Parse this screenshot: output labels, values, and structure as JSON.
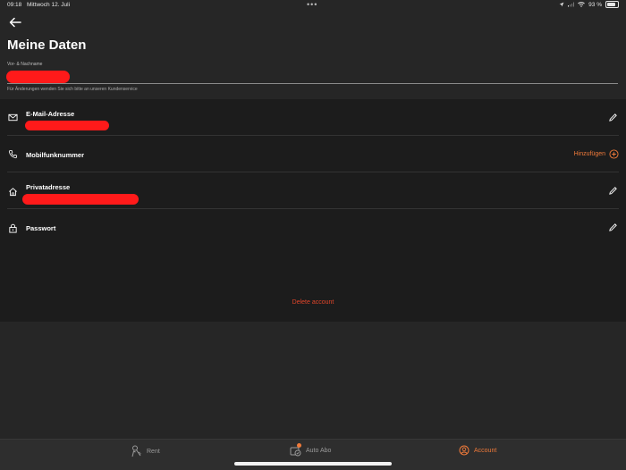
{
  "status_bar": {
    "time": "09:18",
    "date": "Mittwoch 12. Juli",
    "battery": "93 %"
  },
  "page": {
    "title": "Meine Daten",
    "name_label": "Vor- & Nachname",
    "hint": "Für Änderungen wenden Sie sich bitte an unseren Kundenservice"
  },
  "rows": {
    "email": {
      "label": "E-Mail-Adresse",
      "icon": "mail-icon"
    },
    "phone": {
      "label": "Mobilfunknummer",
      "icon": "phone-icon",
      "action_label": "Hinzufügen"
    },
    "address": {
      "label": "Privatadresse",
      "icon": "home-icon"
    },
    "password": {
      "label": "Passwort",
      "icon": "lock-icon"
    }
  },
  "delete_label": "Delete account",
  "tabs": [
    {
      "label": "Rent",
      "icon": "rent-icon",
      "active": false
    },
    {
      "label": "Auto Abo",
      "icon": "auto-abo-icon",
      "active": false
    },
    {
      "label": "Account",
      "icon": "account-icon",
      "active": true
    }
  ],
  "colors": {
    "accent": "#f07a3a",
    "danger": "#e0452a",
    "background": "#262626",
    "card": "#1c1c1c"
  }
}
